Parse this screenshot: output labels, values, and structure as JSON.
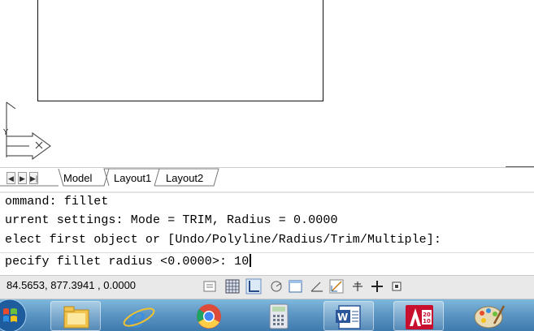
{
  "layout_tabs": {
    "model": "Model",
    "layout1": "Layout1",
    "layout2": "Layout2"
  },
  "command_history": [
    "ommand: fillet",
    "urrent settings: Mode = TRIM, Radius = 0.0000",
    "elect first object or [Undo/Polyline/Radius/Trim/Multiple]:"
  ],
  "command_input": {
    "prompt": "pecify fillet radius <0.0000>: ",
    "value": "10"
  },
  "status_bar": {
    "coordinates": "84.5653, 877.3941 , 0.0000",
    "toggles": [
      "quick-view-icon",
      "grid-icon",
      "ortho-icon",
      "polar-icon",
      "object-snap-icon",
      "otrack-icon",
      "dynamic-ucs-icon",
      "lineweight-icon",
      "cross-icon",
      "properties-icon"
    ]
  },
  "taskbar": {
    "items": [
      "start-orb-icon",
      "file-explorer-icon",
      "internet-explorer-icon",
      "chrome-icon",
      "calculator-icon",
      "word-icon",
      "autocad-icon",
      "paint-icon"
    ],
    "autocad_badge": "20\n10"
  },
  "colors": {
    "taskbar": "#5d97c4",
    "status_bar": "#e9e9e9",
    "autocad_red": "#c8102e"
  }
}
